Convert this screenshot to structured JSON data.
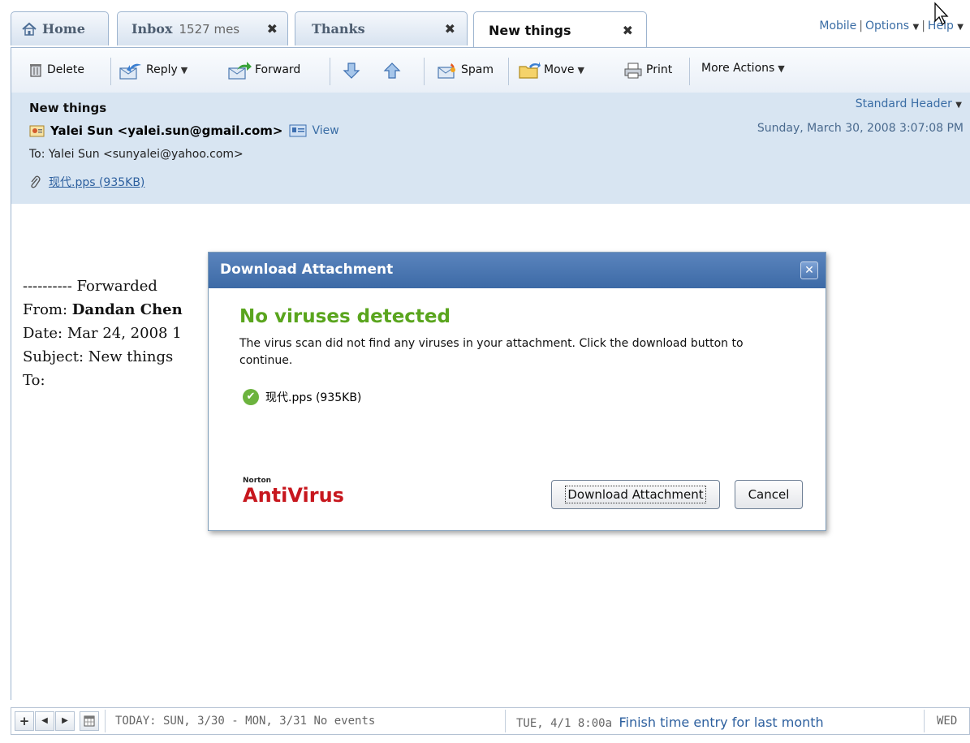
{
  "tabs": [
    {
      "label": "Home"
    },
    {
      "label": "Inbox",
      "count": "1527 mes"
    },
    {
      "label": "Thanks"
    },
    {
      "label": "New things"
    }
  ],
  "toplinks": {
    "mobile": "Mobile",
    "options": "Options",
    "help": "Help"
  },
  "toolbar": {
    "delete": "Delete",
    "reply": "Reply",
    "forward": "Forward",
    "spam": "Spam",
    "move": "Move",
    "print": "Print",
    "more_actions": "More Actions"
  },
  "message": {
    "subject": "New things",
    "from": "Yalei Sun <yalei.sun@gmail.com>",
    "view": "View",
    "to": "To: Yalei Sun <sunyalei@yahoo.com>",
    "attachment": "现代.pps (935KB)",
    "header_type": "Standard Header",
    "date": "Sunday, March 30, 2008 3:07:08 PM",
    "body_lines": [
      "---------- Forwarded",
      "From: ",
      "Date: Mar 24, 2008 1",
      "Subject: New things",
      "To:"
    ],
    "from_name": "Dandan Chen"
  },
  "modal": {
    "title": "Download Attachment",
    "heading": "No viruses detected",
    "description": "The virus scan did not find any viruses in your attachment. Click the download button to continue.",
    "file": "现代.pps (935KB)",
    "norton_small": "Norton",
    "norton_big": "AntiVirus",
    "download_button": "Download Attachment",
    "cancel_button": "Cancel"
  },
  "calendar": {
    "today": "TODAY: SUN, 3/30 - MON, 3/31",
    "no_events": "No events",
    "next_day": "TUE, 4/1",
    "event_time": "8:00a",
    "event_title": "Finish time entry for last month",
    "after": "WED"
  }
}
